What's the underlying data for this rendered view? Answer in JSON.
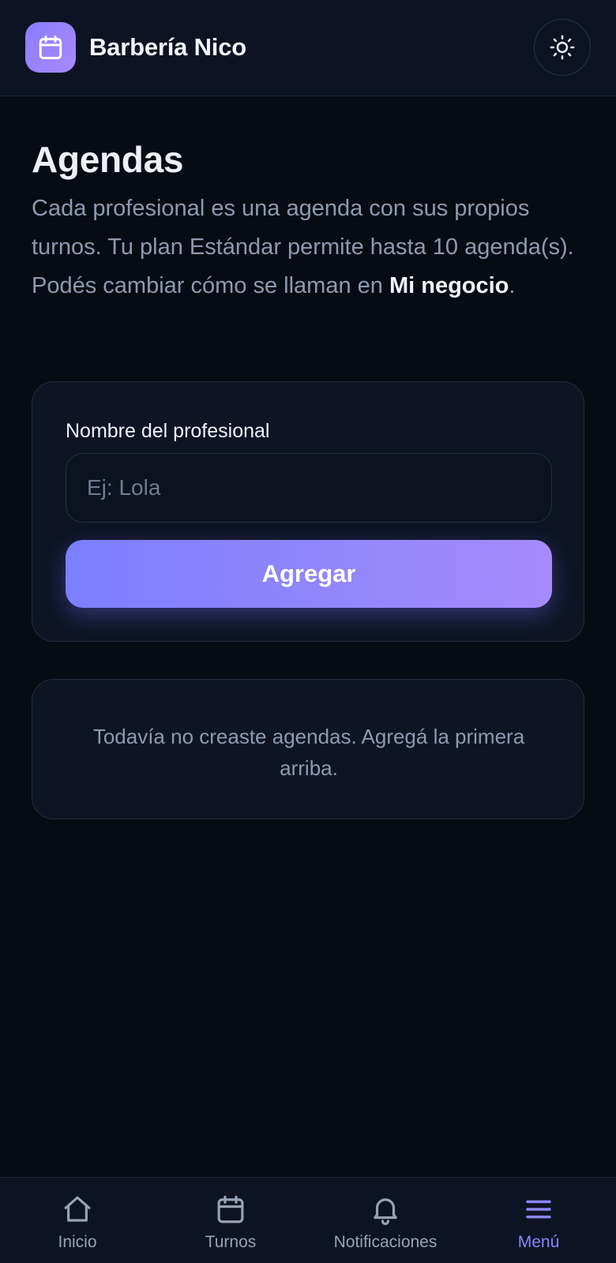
{
  "header": {
    "brand_name": "Barbería Nico",
    "brand_icon": "calendar-icon",
    "theme_toggle_icon": "sun-icon"
  },
  "main": {
    "title": "Agendas",
    "description_text": "Cada profesional es una agenda con sus propios turnos. Tu plan Estándar permite hasta 10 agenda(s). Podés cambiar cómo se llaman en ",
    "description_link": "Mi negocio",
    "description_end": ".",
    "form": {
      "label": "Nombre del profesional",
      "input_value": "",
      "input_placeholder": "Ej: Lola",
      "submit_label": "Agregar"
    },
    "empty_state": "Todavía no creaste agendas. Agregá la primera arriba."
  },
  "bottom_nav": {
    "items": [
      {
        "label": "Inicio",
        "icon": "home-icon",
        "active": false
      },
      {
        "label": "Turnos",
        "icon": "calendar-icon",
        "active": false
      },
      {
        "label": "Notificaciones",
        "icon": "bell-icon",
        "active": false
      },
      {
        "label": "Menú",
        "icon": "menu-icon",
        "active": true
      }
    ]
  },
  "colors": {
    "background": "#070b14",
    "surface": "#0e1424",
    "accent_start": "#7b7fff",
    "accent_end": "#a58bfa",
    "active_nav": "#8a86ff",
    "muted_text": "#8e9ab0"
  }
}
